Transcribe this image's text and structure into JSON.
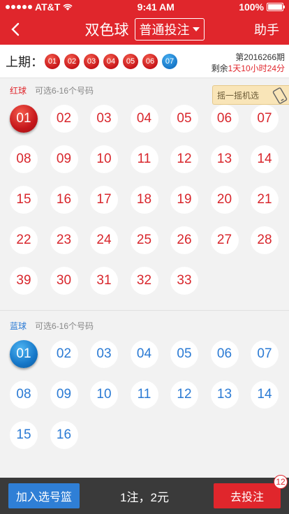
{
  "status": {
    "carrier": "AT&T",
    "time": "9:41 AM",
    "battery": "100%"
  },
  "nav": {
    "title": "双色球",
    "mode": "普通投注",
    "helper": "助手"
  },
  "last_draw": {
    "label": "上期：",
    "red_balls": [
      "01",
      "02",
      "03",
      "04",
      "05",
      "06"
    ],
    "blue_ball": "07",
    "issue": "第2016266期",
    "remaining_prefix": "剩余",
    "remaining_time": "1天10小时24分"
  },
  "red_section": {
    "tag": "红球",
    "hint": "可选6-16个号码",
    "shake_label": "摇一摇机选",
    "numbers": [
      "01",
      "02",
      "03",
      "04",
      "05",
      "06",
      "07",
      "08",
      "09",
      "10",
      "11",
      "12",
      "13",
      "14",
      "15",
      "16",
      "17",
      "18",
      "19",
      "20",
      "21",
      "22",
      "23",
      "24",
      "25",
      "26",
      "27",
      "28",
      "39",
      "30",
      "31",
      "32",
      "33"
    ],
    "selected": [
      "01"
    ]
  },
  "blue_section": {
    "tag": "蓝球",
    "hint": "可选6-16个号码",
    "numbers": [
      "01",
      "02",
      "03",
      "04",
      "05",
      "06",
      "07",
      "08",
      "09",
      "10",
      "11",
      "12",
      "13",
      "14",
      "15",
      "16"
    ],
    "selected": [
      "01"
    ]
  },
  "bottom": {
    "add_label": "加入选号篮",
    "summary": "1注，2元",
    "submit_label": "去投注",
    "badge": "12"
  },
  "colors": {
    "brand_red": "#e0262c",
    "blue": "#2a7ad4",
    "bottom_bg": "#3a3a3a"
  }
}
